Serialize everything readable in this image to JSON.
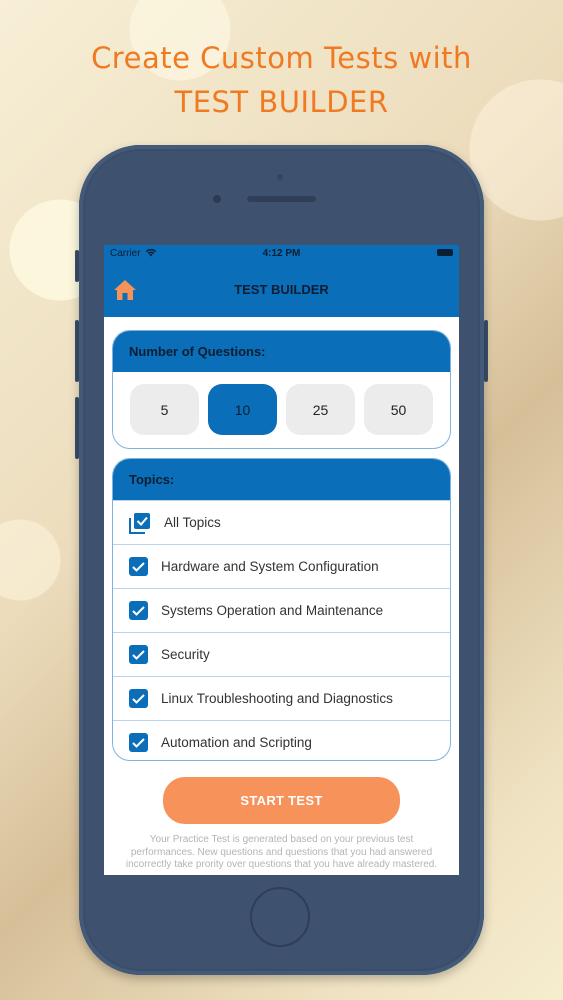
{
  "headline": {
    "line1": "Create Custom Tests with",
    "line2": "TEST BUILDER"
  },
  "status_bar": {
    "carrier": "Carrier",
    "time": "4:12 PM"
  },
  "nav": {
    "title": "TEST BUILDER",
    "home_icon": "home-icon"
  },
  "questions": {
    "header": "Number of Questions:",
    "options": [
      "5",
      "10",
      "25",
      "50"
    ],
    "selected": "10"
  },
  "topics": {
    "header": "Topics:",
    "items": [
      {
        "label": "All Topics",
        "checked": true,
        "icon": "multi-checkbox-icon"
      },
      {
        "label": "Hardware and System Configuration",
        "checked": true
      },
      {
        "label": "Systems Operation and Maintenance",
        "checked": true
      },
      {
        "label": "Security",
        "checked": true
      },
      {
        "label": "Linux Troubleshooting and Diagnostics",
        "checked": true
      },
      {
        "label": "Automation and Scripting",
        "checked": true
      }
    ]
  },
  "start_button": "START TEST",
  "note": "Your Practice Test is generated based on your previous test performances. New questions and questions that you had answered incorrectly take prority over questions that you have already mastered.",
  "colors": {
    "accent": "#0a6eb8",
    "cta": "#f7925a",
    "headline": "#f07a22",
    "home_icon": "#f7925a"
  }
}
